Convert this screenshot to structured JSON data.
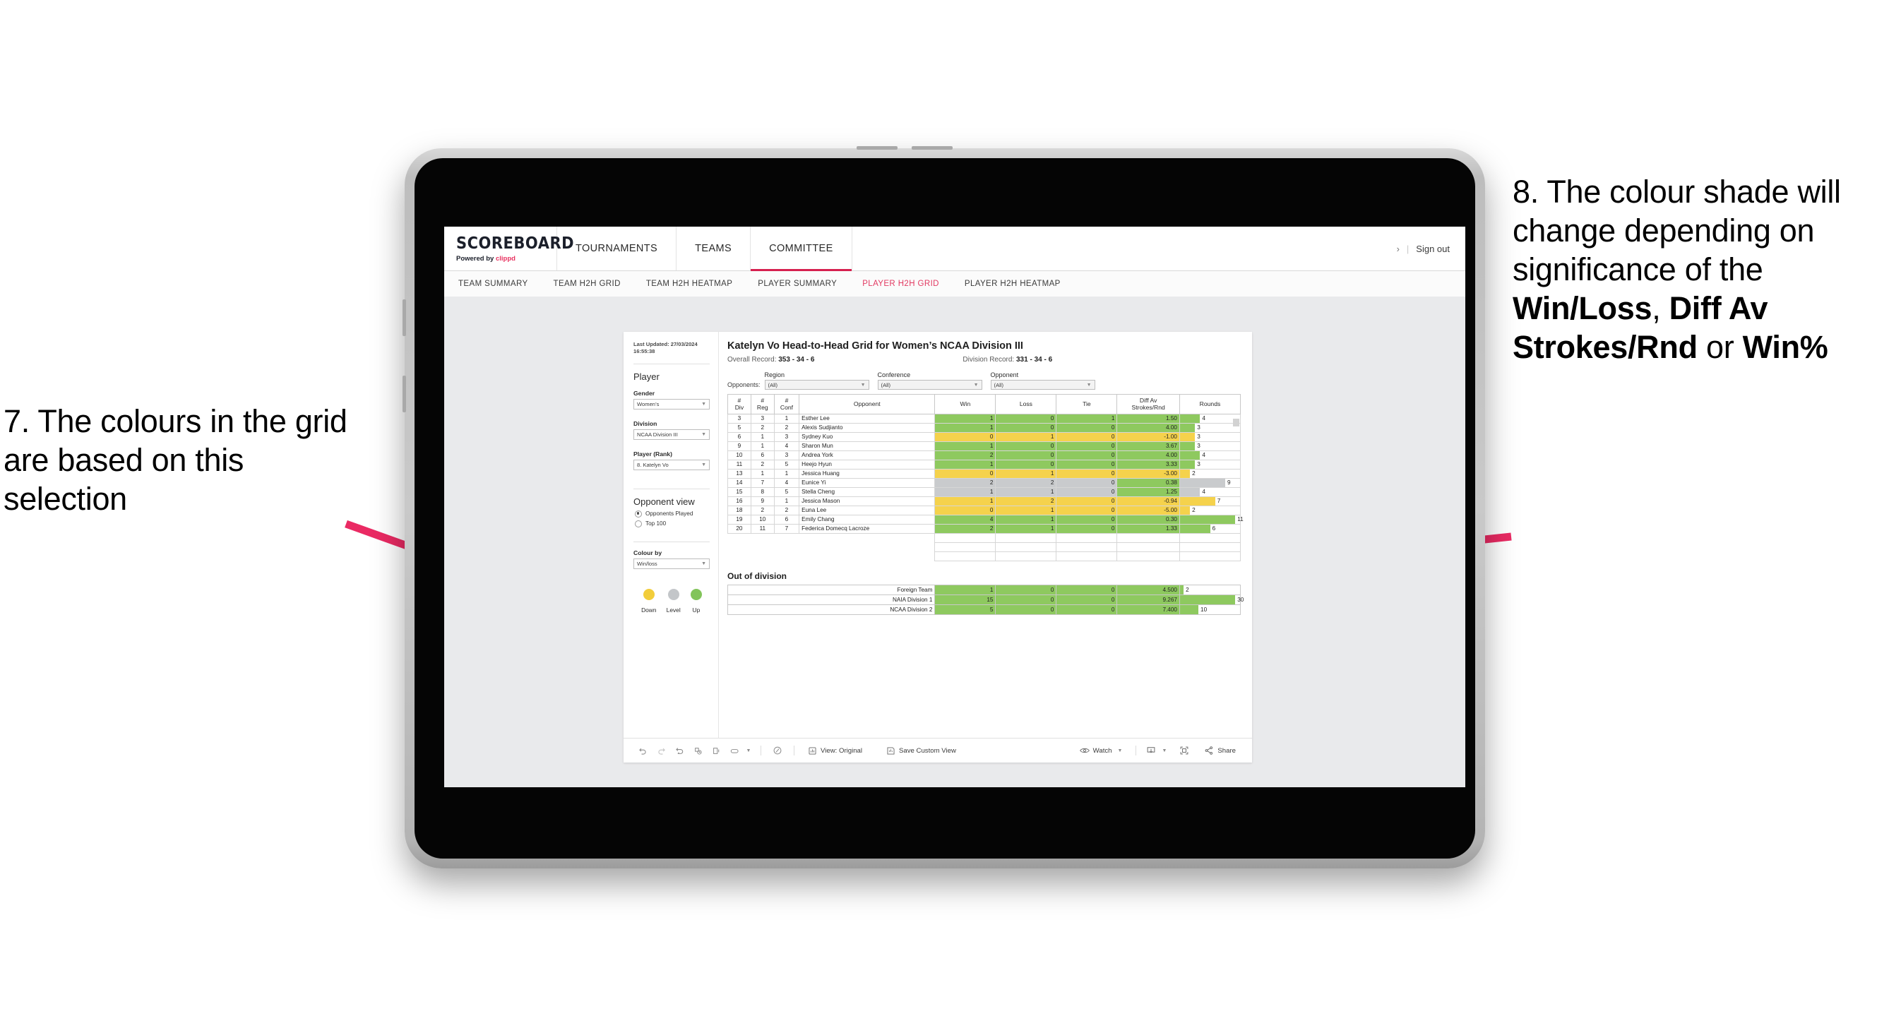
{
  "annotations": {
    "left": "7. The colours in the grid are based on this selection",
    "right_prefix": "8. The colour shade will change depending on significance of the ",
    "right_bold_1": "Win/Loss",
    "right_mid_1": ", ",
    "right_bold_2": "Diff Av Strokes/Rnd",
    "right_mid_2": " or ",
    "right_bold_3": "Win%",
    "arrow_color": "#ea2a63"
  },
  "app": {
    "brand": {
      "name": "SCOREBOARD",
      "powered_prefix": "Powered by ",
      "powered_brand": "clippd"
    },
    "topnav": {
      "items": [
        {
          "label": "TOURNAMENTS",
          "active": false
        },
        {
          "label": "TEAMS",
          "active": false
        },
        {
          "label": "COMMITTEE",
          "active": true
        }
      ],
      "chevron": "›",
      "divider": "|",
      "signout": "Sign out"
    },
    "subnav": {
      "items": [
        {
          "label": "TEAM SUMMARY",
          "active": false
        },
        {
          "label": "TEAM H2H GRID",
          "active": false
        },
        {
          "label": "TEAM H2H HEATMAP",
          "active": false
        },
        {
          "label": "PLAYER SUMMARY",
          "active": false
        },
        {
          "label": "PLAYER H2H GRID",
          "active": true
        },
        {
          "label": "PLAYER H2H HEATMAP",
          "active": false
        }
      ],
      "active_color": "#e23a62"
    },
    "sidebar": {
      "last_updated": "Last Updated: 27/03/2024 16:55:38",
      "player_heading": "Player",
      "gender": {
        "label": "Gender",
        "value": "Women’s"
      },
      "division": {
        "label": "Division",
        "value": "NCAA Division III"
      },
      "player_rank": {
        "label": "Player (Rank)",
        "value": "8. Katelyn Vo"
      },
      "opponent_view": {
        "heading": "Opponent view",
        "options": [
          {
            "label": "Opponents Played",
            "selected": true
          },
          {
            "label": "Top 100",
            "selected": false
          }
        ]
      },
      "colour_by": {
        "label": "Colour by",
        "value": "Win/loss"
      },
      "legend": [
        {
          "label": "Down",
          "color": "#f2cd3b"
        },
        {
          "label": "Level",
          "color": "#c3c6c9"
        },
        {
          "label": "Up",
          "color": "#82c45a"
        }
      ]
    },
    "main": {
      "title": "Katelyn Vo Head-to-Head Grid for Women’s NCAA Division III",
      "overall_record_label": "Overall Record: ",
      "overall_record_value": "353 -  34 - 6",
      "division_record_label": "Division Record: ",
      "division_record_value": "331 -  34 - 6",
      "opponents_label": "Opponents:",
      "filters": [
        {
          "label": "Region",
          "value": "(All)"
        },
        {
          "label": "Conference",
          "value": "(All)"
        },
        {
          "label": "Opponent",
          "value": "(All)"
        }
      ],
      "columns": [
        "# Div",
        "# Reg",
        "# Conf",
        "Opponent",
        "Win",
        "Loss",
        "Tie",
        "Diff Av Strokes/Rnd",
        "Rounds"
      ],
      "column_lines": [
        [
          "#",
          "Div"
        ],
        [
          "#",
          "Reg"
        ],
        [
          "#",
          "Conf"
        ],
        [
          "Opponent",
          ""
        ],
        [
          "Win",
          ""
        ],
        [
          "Loss",
          ""
        ],
        [
          "Tie",
          ""
        ],
        [
          "Diff Av",
          "Strokes/Rnd"
        ],
        [
          "Rounds",
          ""
        ]
      ],
      "rows": [
        {
          "div": "3",
          "reg": "3",
          "conf": "1",
          "opponent": "Esther Lee",
          "win": "1",
          "loss": "0",
          "tie": "1",
          "diff": "1.50",
          "rounds": "4",
          "shade": "up"
        },
        {
          "div": "5",
          "reg": "2",
          "conf": "2",
          "opponent": "Alexis Sudjianto",
          "win": "1",
          "loss": "0",
          "tie": "0",
          "diff": "4.00",
          "rounds": "3",
          "shade": "up"
        },
        {
          "div": "6",
          "reg": "1",
          "conf": "3",
          "opponent": "Sydney Kuo",
          "win": "0",
          "loss": "1",
          "tie": "0",
          "diff": "-1.00",
          "rounds": "3",
          "shade": "down"
        },
        {
          "div": "9",
          "reg": "1",
          "conf": "4",
          "opponent": "Sharon Mun",
          "win": "1",
          "loss": "0",
          "tie": "0",
          "diff": "3.67",
          "rounds": "3",
          "shade": "up"
        },
        {
          "div": "10",
          "reg": "6",
          "conf": "3",
          "opponent": "Andrea York",
          "win": "2",
          "loss": "0",
          "tie": "0",
          "diff": "4.00",
          "rounds": "4",
          "shade": "up"
        },
        {
          "div": "11",
          "reg": "2",
          "conf": "5",
          "opponent": "Heejo Hyun",
          "win": "1",
          "loss": "0",
          "tie": "0",
          "diff": "3.33",
          "rounds": "3",
          "shade": "up"
        },
        {
          "div": "13",
          "reg": "1",
          "conf": "1",
          "opponent": "Jessica Huang",
          "win": "0",
          "loss": "1",
          "tie": "0",
          "diff": "-3.00",
          "rounds": "2",
          "shade": "down"
        },
        {
          "div": "14",
          "reg": "7",
          "conf": "4",
          "opponent": "Eunice Yi",
          "win": "2",
          "loss": "2",
          "tie": "0",
          "diff": "0.38",
          "rounds": "9",
          "shade": "level",
          "diff_shade": "up"
        },
        {
          "div": "15",
          "reg": "8",
          "conf": "5",
          "opponent": "Stella Cheng",
          "win": "1",
          "loss": "1",
          "tie": "0",
          "diff": "1.25",
          "rounds": "4",
          "shade": "level",
          "diff_shade": "up"
        },
        {
          "div": "16",
          "reg": "9",
          "conf": "1",
          "opponent": "Jessica Mason",
          "win": "1",
          "loss": "2",
          "tie": "0",
          "diff": "-0.94",
          "rounds": "7",
          "shade": "down"
        },
        {
          "div": "18",
          "reg": "2",
          "conf": "2",
          "opponent": "Euna Lee",
          "win": "0",
          "loss": "1",
          "tie": "0",
          "diff": "-5.00",
          "rounds": "2",
          "shade": "down"
        },
        {
          "div": "19",
          "reg": "10",
          "conf": "6",
          "opponent": "Emily Chang",
          "win": "4",
          "loss": "1",
          "tie": "0",
          "diff": "0.30",
          "rounds": "11",
          "shade": "up"
        },
        {
          "div": "20",
          "reg": "11",
          "conf": "7",
          "opponent": "Federica Domecq Lacroze",
          "win": "2",
          "loss": "1",
          "tie": "0",
          "diff": "1.33",
          "rounds": "6",
          "shade": "up"
        }
      ],
      "out_of_division": {
        "heading": "Out of division",
        "rows": [
          {
            "name": "Foreign Team",
            "win": "1",
            "loss": "0",
            "tie": "0",
            "diff": "4.500",
            "rounds": "2",
            "shade": "up"
          },
          {
            "name": "NAIA Division 1",
            "win": "15",
            "loss": "0",
            "tie": "0",
            "diff": "9.267",
            "rounds": "30",
            "shade": "up"
          },
          {
            "name": "NCAA Division 2",
            "win": "5",
            "loss": "0",
            "tie": "0",
            "diff": "7.400",
            "rounds": "10",
            "shade": "up"
          }
        ]
      }
    },
    "toolbar": {
      "icons": [
        "undo-icon",
        "redo-icon",
        "revert-icon",
        "refresh-data-icon",
        "pause-updates-icon",
        "shape-icon",
        "shape-caret-icon"
      ],
      "alerts_icon": "alerts-icon",
      "view_original": "View: Original",
      "save_custom_view": "Save Custom View",
      "watch": "Watch",
      "download_icon": "download-icon",
      "fullscreen_icon": "fullscreen-icon",
      "share": "Share"
    }
  },
  "colors": {
    "up": "#8ec95f",
    "down": "#f5d24c",
    "level": "#c9cbcd",
    "accent": "#d6204f"
  }
}
